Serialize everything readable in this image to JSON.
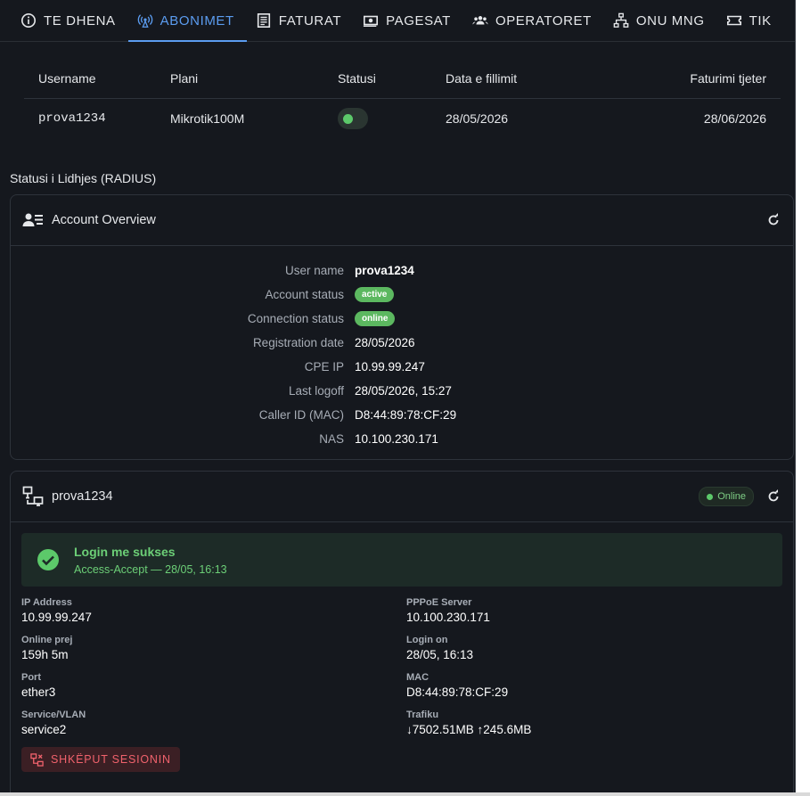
{
  "tabs": [
    {
      "label": "TE DHENA",
      "icon": "info-icon"
    },
    {
      "label": "ABONIMET",
      "icon": "antenna-icon",
      "active": true
    },
    {
      "label": "FATURAT",
      "icon": "invoice-icon"
    },
    {
      "label": "PAGESAT",
      "icon": "cash-icon"
    },
    {
      "label": "OPERATORET",
      "icon": "people-icon"
    },
    {
      "label": "ONU MNG",
      "icon": "network-icon"
    },
    {
      "label": "TIK",
      "icon": "ticket-icon"
    }
  ],
  "subscriptions": {
    "headers": [
      "Username",
      "Plani",
      "Statusi",
      "Data e fillimit",
      "Faturimi tjeter"
    ],
    "rows": [
      {
        "username": "prova1234",
        "plan": "Mikrotik100M",
        "status_on": true,
        "start": "28/05/2026",
        "next_invoice": "28/06/2026"
      }
    ]
  },
  "section_title": "Statusi i Lidhjes (RADIUS)",
  "account_overview": {
    "title": "Account Overview",
    "rows": [
      {
        "label": "User name",
        "value": "prova1234"
      },
      {
        "label": "Account status",
        "value": "active"
      },
      {
        "label": "Connection status",
        "value": "online"
      },
      {
        "label": "Registration date",
        "value": "28/05/2026"
      },
      {
        "label": "CPE IP",
        "value": "10.99.99.247"
      },
      {
        "label": "Last logoff",
        "value": "28/05/2026, 15:27"
      },
      {
        "label": "Caller ID (MAC)",
        "value": "D8:44:89:78:CF:29"
      },
      {
        "label": "NAS",
        "value": "10.100.230.171"
      }
    ]
  },
  "session": {
    "title": "prova1234",
    "badge": "Online",
    "success_title": "Login me sukses",
    "success_sub": "Access-Accept — 28/05, 16:13",
    "fields": {
      "ip_label": "IP Address",
      "ip": "10.99.99.247",
      "pppoe_label": "PPPoE Server",
      "pppoe": "10.100.230.171",
      "online_label": "Online prej",
      "online": "159h 5m",
      "login_label": "Login on",
      "login": "28/05, 16:13",
      "port_label": "Port",
      "port": "ether3",
      "mac_label": "MAC",
      "mac": "D8:44:89:78:CF:29",
      "service_label": "Service/VLAN",
      "service": "service2",
      "traffic_label": "Trafiku",
      "traffic": "↓7502.51MB ↑245.6MB"
    },
    "disconnect_label": "SHKËPUT SESIONIN"
  },
  "colors": {
    "accent": "#5b9cf0",
    "success": "#5cb860",
    "danger": "#f0626c"
  }
}
